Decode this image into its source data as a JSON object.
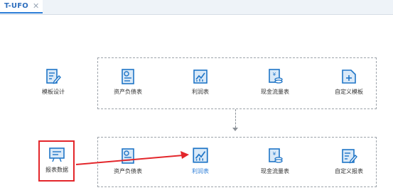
{
  "tab": {
    "label": "T-UFO",
    "close": "✕"
  },
  "design": {
    "label": "模板设计",
    "items": [
      "资产负债表",
      "利润表",
      "现金流量表",
      "自定义模板"
    ]
  },
  "data": {
    "label": "报表数据",
    "items": [
      "资产负债表",
      "利润表",
      "现金流量表",
      "自定义报表"
    ],
    "active_index": 1
  },
  "colors": {
    "icon": "#1f75c7",
    "icon_light": "#d9e9f8",
    "active_text": "#2f7fd8",
    "highlight": "#e3262b"
  }
}
